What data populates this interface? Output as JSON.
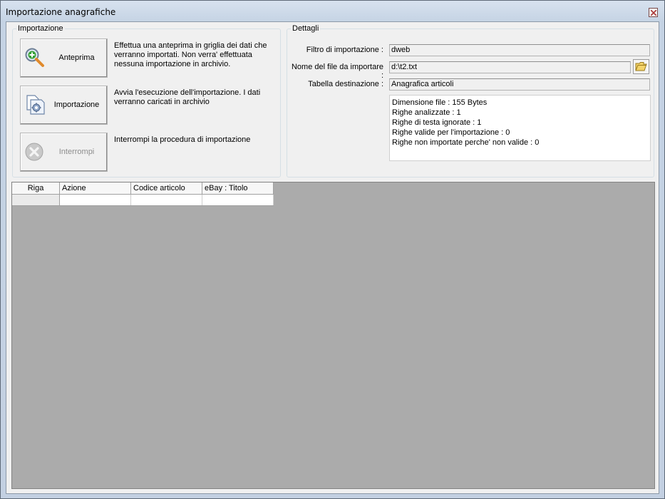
{
  "window": {
    "title": "Importazione anagrafiche"
  },
  "importazione": {
    "label": "Importazione",
    "buttons": [
      {
        "label": "Anteprima",
        "icon": "magnifier-plus-icon",
        "enabled": true,
        "description": "Effettua una anteprima in griglia dei dati che verranno importati. Non verra' effettuata nessuna importazione in archivio."
      },
      {
        "label": "Importazione",
        "icon": "document-gear-icon",
        "enabled": true,
        "description": "Avvia l'esecuzione dell'importazione. I dati verranno caricati in archivio"
      },
      {
        "label": "Interrompi",
        "icon": "stop-x-icon",
        "enabled": false,
        "description": "Interrompi la procedura di importazione"
      }
    ]
  },
  "dettagli": {
    "label": "Dettagli",
    "filtro_label": "Filtro di importazione :",
    "filtro_value": "dweb",
    "file_label": "Nome del file da importare :",
    "file_value": "d:\\t2.txt",
    "tabella_label": "Tabella destinazione :",
    "tabella_value": "Anagrafica articoli",
    "info_lines": [
      "Dimensione file : 155 Bytes",
      "Righe analizzate : 1",
      "Righe di testa ignorate : 1",
      "Righe valide per l'importazione : 0",
      "Righe non importate perche' non valide : 0"
    ]
  },
  "grid": {
    "columns": [
      "Riga",
      "Azione",
      "Codice articolo",
      "eBay : Titolo"
    ],
    "rows": [
      [
        "",
        "",
        "",
        ""
      ]
    ]
  },
  "colors": {
    "titlebar": "#c5d3e4",
    "client": "#f0f0f0",
    "grid_bg": "#ababab",
    "folder": "#f3d36a"
  }
}
